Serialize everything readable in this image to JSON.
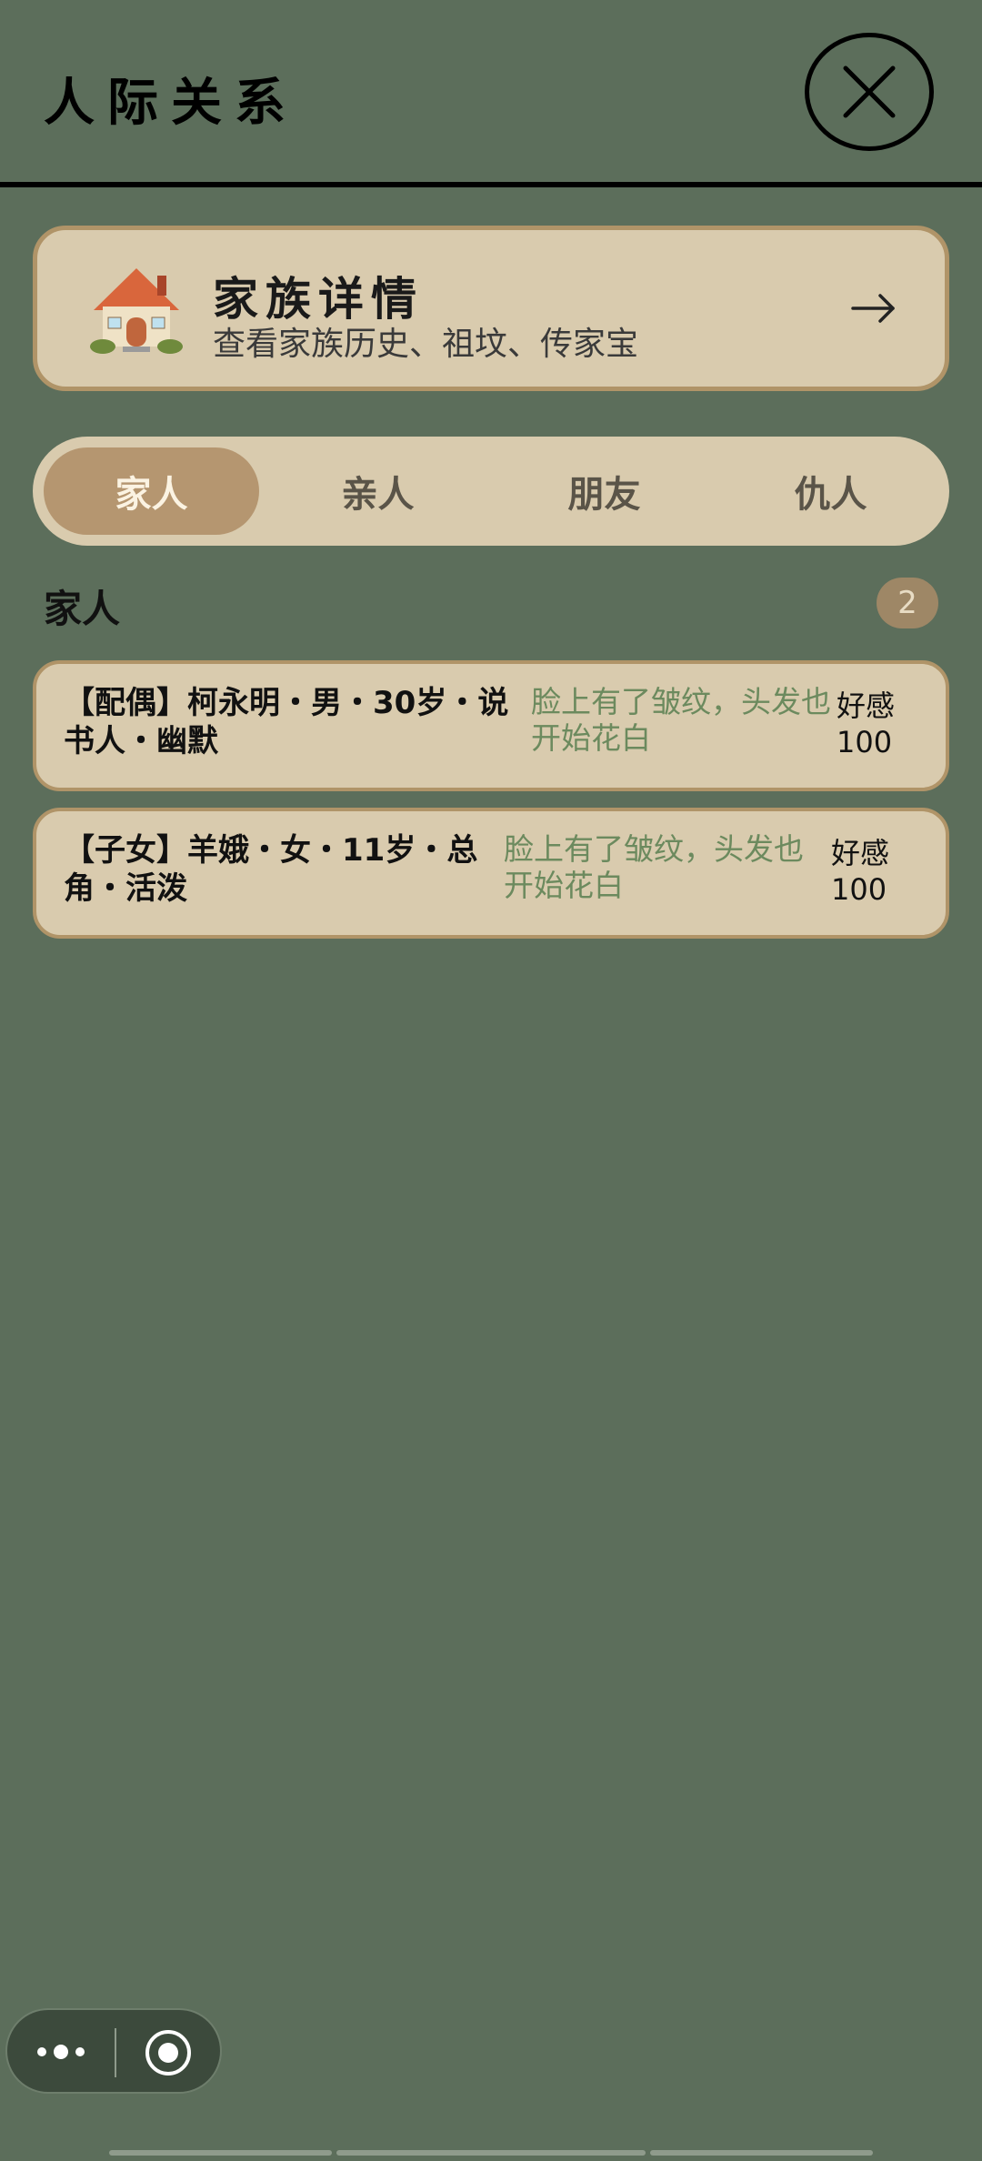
{
  "header": {
    "title": "人际关系"
  },
  "family": {
    "title": "家族详情",
    "subtitle": "查看家族历史、祖坟、传家宝",
    "icon": "house-icon",
    "arrow": "arrow-right-icon"
  },
  "tabs": [
    {
      "label": "家人",
      "active": true
    },
    {
      "label": "亲人",
      "active": false
    },
    {
      "label": "朋友",
      "active": false
    },
    {
      "label": "仇人",
      "active": false
    }
  ],
  "section": {
    "title": "家人",
    "count": "2"
  },
  "members": [
    {
      "info": "【配偶】柯永明・男・30岁・说书人・幽默",
      "desc": "脸上有了皱纹，头发也开始花白",
      "favor_label": "好感",
      "favor_value": "100"
    },
    {
      "info": "【子女】羊娥・女・11岁・总角・活泼",
      "desc": "脸上有了皱纹，头发也开始花白",
      "favor_label": "好感",
      "favor_value": "100"
    }
  ],
  "colors": {
    "background": "#5c6e5b",
    "card": "#d9cbae",
    "accent": "#b59670",
    "desc_green": "#6c8a5e"
  }
}
